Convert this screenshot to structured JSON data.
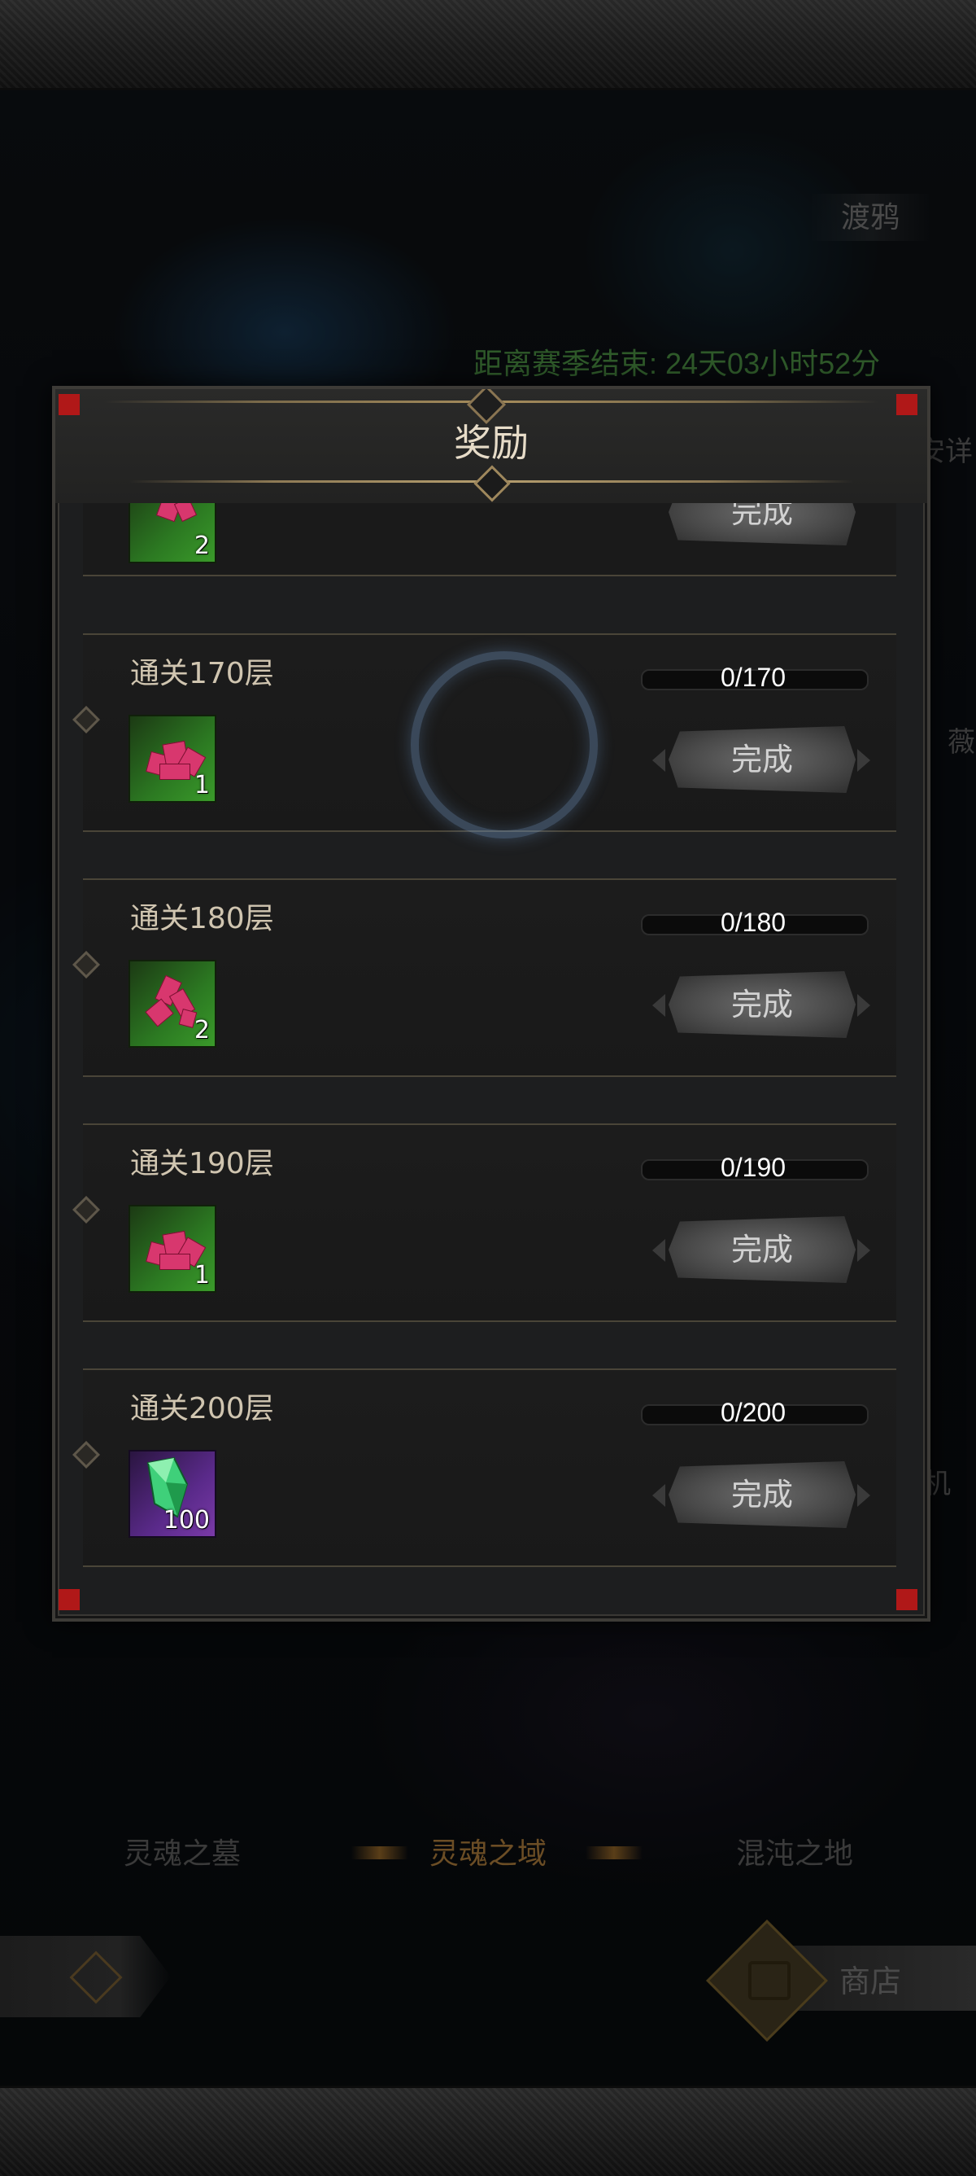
{
  "background": {
    "top_right_label": "渡鸦",
    "countdown": "距离赛季结束: 24天03小时52分",
    "side_right_1": "安详",
    "side_right_2": "薇",
    "side_right_3": "机",
    "nav_tabs": [
      {
        "label": "灵魂之墓",
        "active": false
      },
      {
        "label": "灵魂之域",
        "active": true
      },
      {
        "label": "混沌之地",
        "active": false
      }
    ],
    "shop_label": "商店"
  },
  "modal": {
    "title": "奖励",
    "partial_row": {
      "item_count": "2",
      "button_label": "完成"
    },
    "rows": [
      {
        "title": "通关170层",
        "progress": "0/170",
        "progress_value": 0,
        "item_count": "1",
        "item_type": "pink-crystal-cluster",
        "button_label": "完成"
      },
      {
        "title": "通关180层",
        "progress": "0/180",
        "progress_value": 0,
        "item_count": "2",
        "item_type": "pink-crystal-shards",
        "button_label": "完成"
      },
      {
        "title": "通关190层",
        "progress": "0/190",
        "progress_value": 0,
        "item_count": "1",
        "item_type": "pink-crystal-cluster",
        "button_label": "完成"
      },
      {
        "title": "通关200层",
        "progress": "0/200",
        "progress_value": 0,
        "item_count": "100",
        "item_type": "green-gem",
        "button_label": "完成"
      }
    ]
  },
  "colors": {
    "modal_bg": "#1d1e1f",
    "title_text": "#e7dcc8",
    "row_title_text": "#d0c5b0",
    "accent_gold": "#b59e6e",
    "countdown_text": "#2f5a2a",
    "corner_red": "#b01818"
  }
}
